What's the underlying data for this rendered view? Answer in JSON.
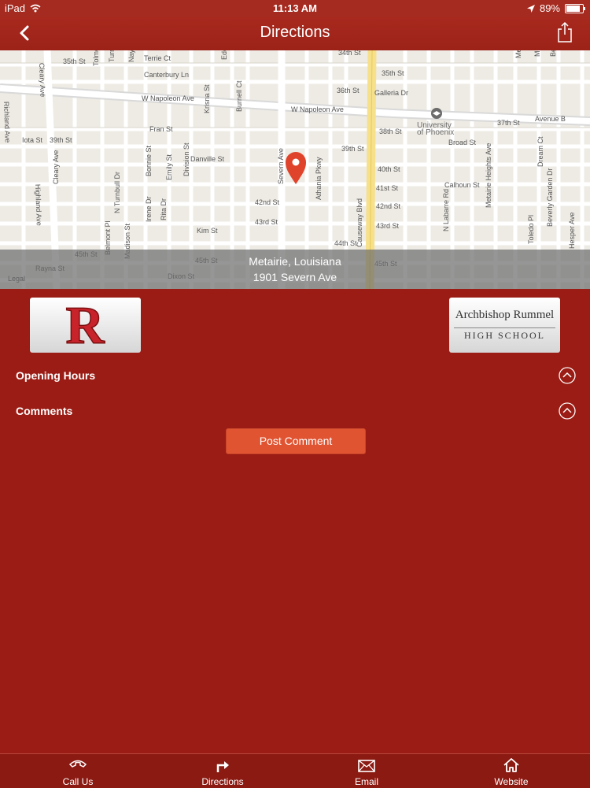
{
  "status_bar": {
    "device": "iPad",
    "time": "11:13 AM",
    "battery": "89%",
    "battery_level": 0.89
  },
  "nav": {
    "title": "Directions"
  },
  "map": {
    "city": "Metairie, Louisiana",
    "address": "1901 Severn Ave",
    "legal": "Legal",
    "poi": [
      "University",
      "of Phoenix"
    ],
    "labels": [
      "Cleary Ave",
      "35th St",
      "Terrie Ct",
      "Canterbury Ln",
      "W Napoleon Ave",
      "W Napoleon Ave",
      "Fran St",
      "Iota St",
      "39th St",
      "Danville St",
      "Severn Ave",
      "42nd St",
      "43rd St",
      "Kim St",
      "45th St",
      "45th St",
      "Rayna St",
      "Dixon St",
      "Richland Ave",
      "Highland Ave",
      "Cleary Ave",
      "34th St",
      "35th St",
      "36th St",
      "Galleria Dr",
      "38th St",
      "39th St",
      "40th St",
      "41st St",
      "42nd St",
      "43rd St",
      "44th St",
      "45th St",
      "Broad St",
      "Calhoun St",
      "Avenue B",
      "37th St",
      "Athania Pkwy",
      "Causeway Blvd",
      "N Labarre Rd",
      "Metairie Heights Ave",
      "Toledo Pl",
      "Beverly Garden Dr",
      "Hesper Ave",
      "Metairie Ct",
      "Melody Dr",
      "Beverly Garden Dr",
      "Dream Ct",
      "Edenborn Ave",
      "Burnell Ct",
      "Krisna St",
      "Division St",
      "Emily St",
      "Bonnie St",
      "Rita Dr",
      "Irene Dr",
      "N Turnbull Dr",
      "Turnbull Dr",
      "Tolmont Dr",
      "Nayley Dr",
      "Belmont Pl",
      "Madison St"
    ]
  },
  "logos": {
    "left_letter": "R",
    "right_line1": "Archbishop Rummel",
    "right_line2": "HIGH SCHOOL"
  },
  "sections": {
    "opening_hours": "Opening Hours",
    "comments": "Comments"
  },
  "post_comment": "Post Comment",
  "tabs": [
    {
      "label": "Call Us",
      "icon": "phone-icon"
    },
    {
      "label": "Directions",
      "icon": "turn-right-arrow-icon"
    },
    {
      "label": "Email",
      "icon": "envelope-icon"
    },
    {
      "label": "Website",
      "icon": "home-icon"
    }
  ],
  "colors": {
    "brand_red": "#9b1c14",
    "button": "#e05432",
    "pin": "#e0432c"
  }
}
